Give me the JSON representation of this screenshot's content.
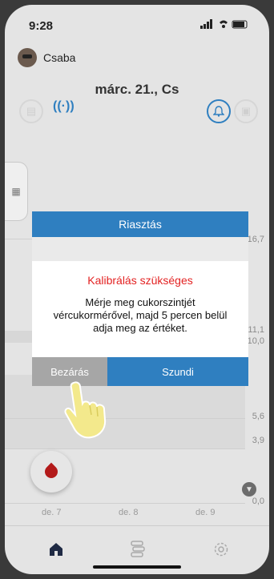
{
  "status_bar": {
    "time": "9:28"
  },
  "header": {
    "user_name": "Csaba",
    "date": "márc. 21., Cs"
  },
  "chart": {
    "y_labels": [
      "16,7",
      "11,1",
      "10,0",
      "5,6",
      "3,9",
      "0,0"
    ],
    "x_labels": [
      "de. 7",
      "de. 8",
      "de. 9"
    ]
  },
  "modal": {
    "header": "Riasztás",
    "title": "Kalibrálás szükséges",
    "message_line1": "Mérje meg cukorszintjét",
    "message_line2": "vércukormérővel, majd 5 percen belül",
    "message_line3": "adja meg az értéket.",
    "close_label": "Bezárás",
    "snooze_label": "Szundi"
  },
  "colors": {
    "accent": "#2f7fc0",
    "alert_red": "#e32222",
    "drop_red": "#b31a1a"
  }
}
